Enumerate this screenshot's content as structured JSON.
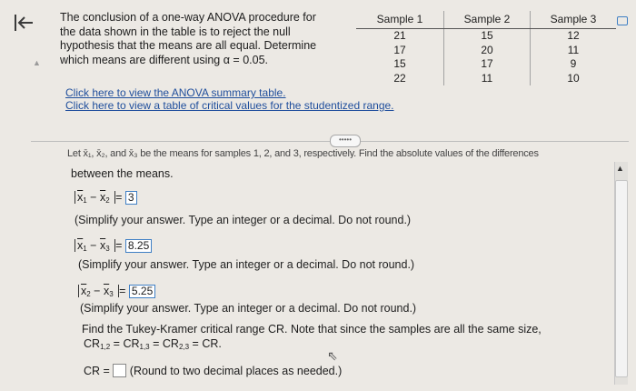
{
  "nav": {
    "back_icon": "K←"
  },
  "question": {
    "text": "The conclusion of a one-way ANOVA procedure for the data shown in the table is to reject the null hypothesis that the means are all equal. Determine which means are different using α = 0.05."
  },
  "table": {
    "headers": [
      "Sample 1",
      "Sample 2",
      "Sample 3"
    ],
    "rows": [
      [
        "21",
        "15",
        "12"
      ],
      [
        "17",
        "20",
        "11"
      ],
      [
        "15",
        "17",
        "9"
      ],
      [
        "22",
        "11",
        "10"
      ]
    ]
  },
  "links": {
    "anova": "Click here to view the ANOVA summary table.",
    "critical": "Click here to view a table of critical values for the studentized range."
  },
  "more_button": "•••••",
  "clipped_line": "Let x̄₁, x̄₂, and x̄₃ be the means for samples 1, 2, and 3, respectively. Find the absolute values of the differences",
  "between": "between the means.",
  "diff12": {
    "x": "x",
    "s1": "1",
    "s2": "2",
    "answer": "3"
  },
  "diff13": {
    "s1": "1",
    "s2": "3",
    "answer": "8.25"
  },
  "diff23": {
    "s1": "2",
    "s2": "3",
    "answer": "5.25"
  },
  "hint_integer": "(Simplify your answer. Type an integer or a decimal. Do not round.)",
  "tukey": {
    "line1": "Find the Tukey-Kramer critical range CR. Note that since the samples are all the same size,",
    "cr": "CR",
    "sub12": "1,2",
    "sub13": "1,3",
    "sub23": "2,3",
    "cr_label": "CR =",
    "cr_hint": "(Round to two decimal places as needed.)"
  }
}
